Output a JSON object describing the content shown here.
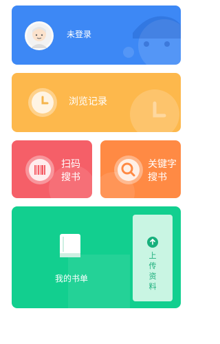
{
  "login_card": {
    "label": "未登录",
    "color": "#3D88F5",
    "icon": "avatar-icon"
  },
  "history_card": {
    "label": "浏览记录",
    "color": "#FDB84C",
    "icon": "clock-icon"
  },
  "scan_card": {
    "label_line1": "扫码",
    "label_line2": "搜书",
    "color": "#F55F68",
    "icon": "barcode-icon"
  },
  "search_card": {
    "label_line1": "关键字",
    "label_line2": "搜书",
    "color": "#FF8A44",
    "icon": "search-icon"
  },
  "bookshelf_card": {
    "label": "我的书单",
    "color": "#12CF8F",
    "icon": "book-icon"
  },
  "upload": {
    "chars": [
      "上",
      "传",
      "资",
      "料"
    ],
    "icon": "upload-icon"
  }
}
